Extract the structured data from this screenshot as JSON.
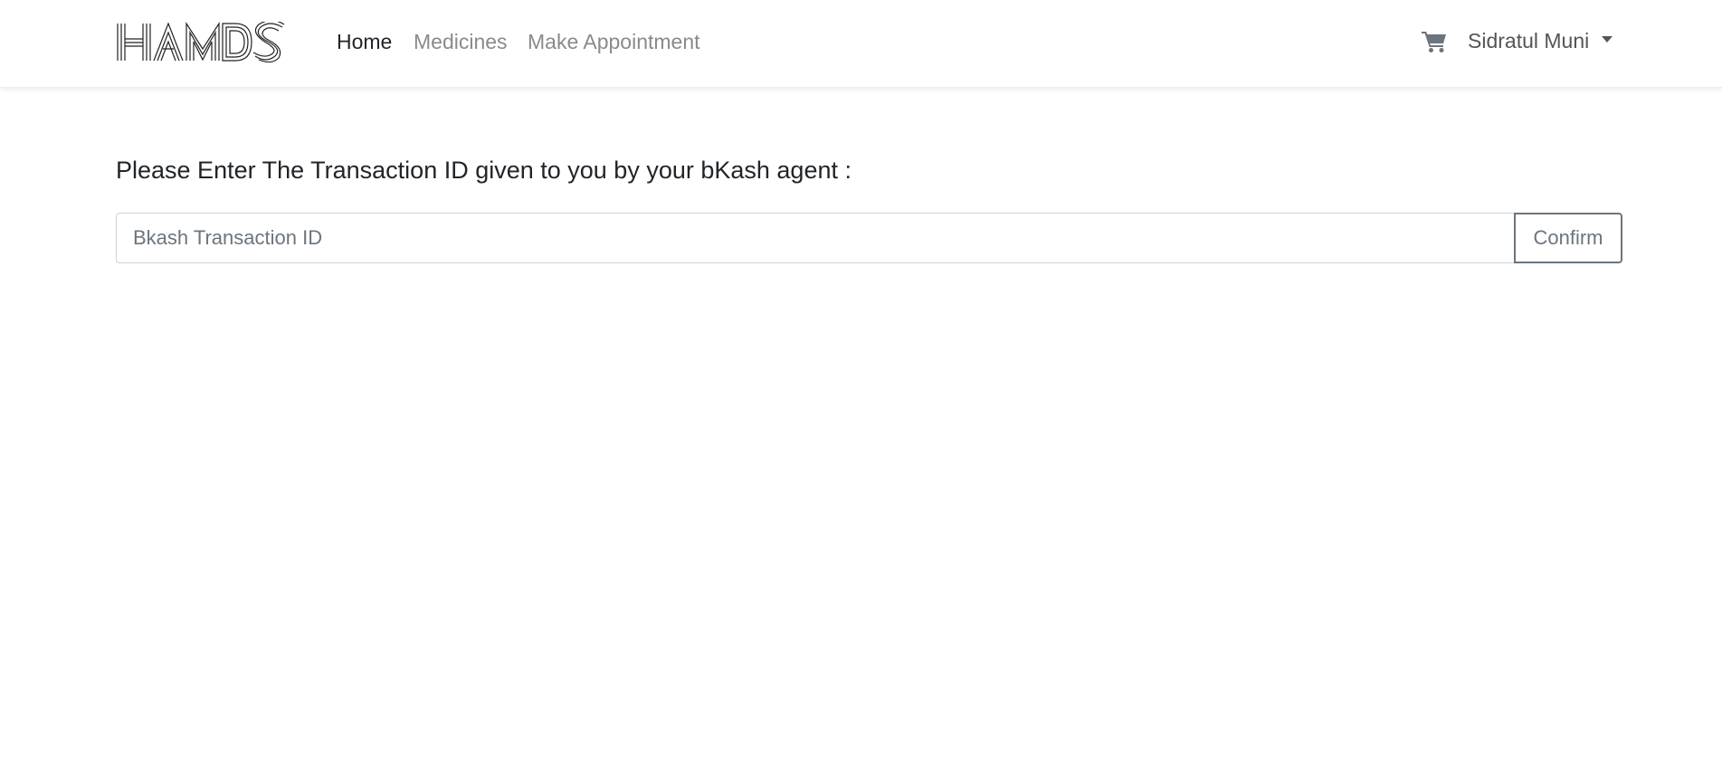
{
  "navbar": {
    "logo_text": "HAMDS",
    "links": [
      {
        "label": "Home",
        "active": true
      },
      {
        "label": "Medicines",
        "active": false
      },
      {
        "label": "Make Appointment",
        "active": false
      }
    ],
    "cart_icon": "shopping-cart-icon",
    "user_name": "Sidratul Muni"
  },
  "main": {
    "prompt": "Please Enter The Transaction ID given to you by your bKash agent :",
    "input_placeholder": "Bkash Transaction ID",
    "input_value": "",
    "confirm_label": "Confirm"
  },
  "colors": {
    "text": "#212529",
    "muted_link": "#8a8a8a",
    "button_border": "#6c757d"
  }
}
